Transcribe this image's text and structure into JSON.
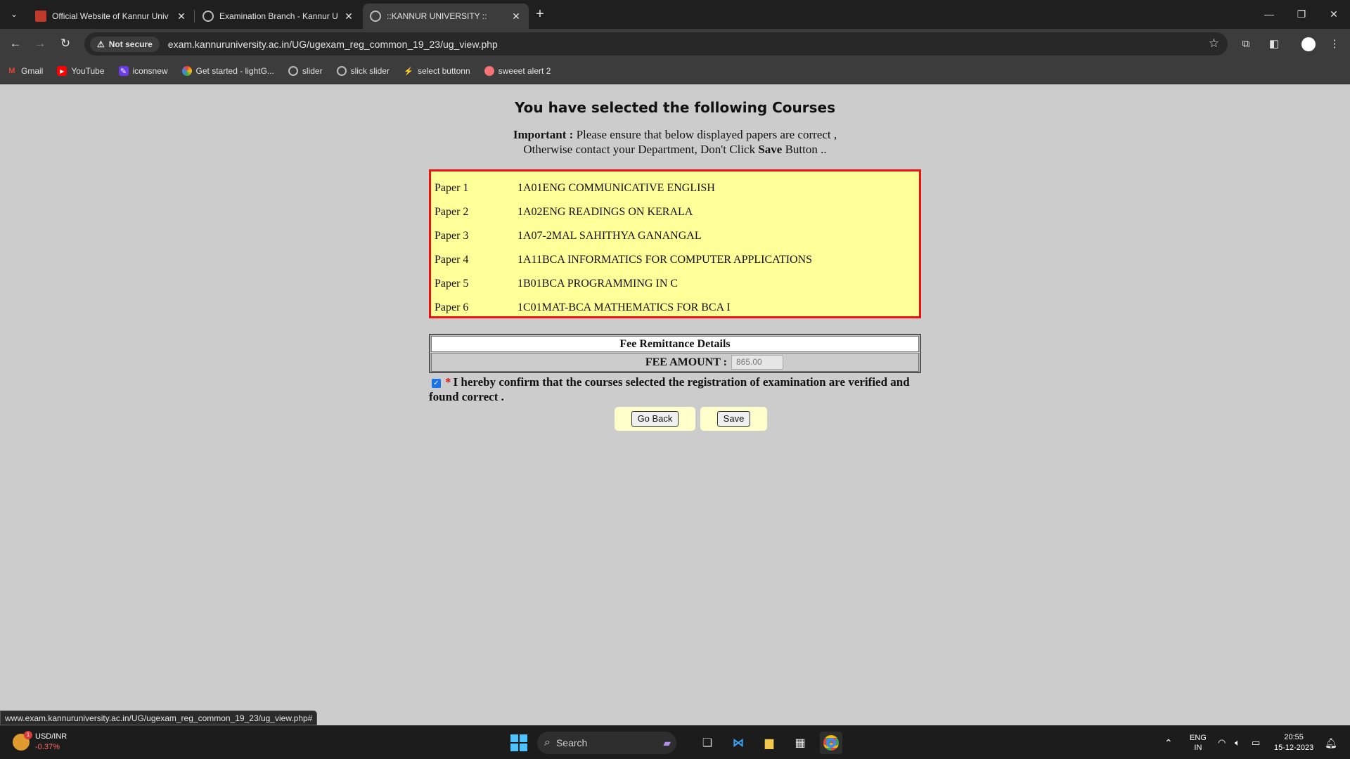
{
  "browser": {
    "tabs": [
      {
        "label": "Official Website of Kannur Univ",
        "active": false
      },
      {
        "label": "Examination Branch - Kannur U",
        "active": false
      },
      {
        "label": "::KANNUR UNIVERSITY ::",
        "active": true
      }
    ],
    "security_label": "Not secure",
    "url": "exam.kannuruniversity.ac.in/UG/ugexam_reg_common_19_23/ug_view.php",
    "bookmarks": [
      {
        "label": "Gmail",
        "icon": "gmail-icon"
      },
      {
        "label": "YouTube",
        "icon": "youtube-icon"
      },
      {
        "label": "iconsnew",
        "icon": "iconsnew-icon"
      },
      {
        "label": "Get started - lightG...",
        "icon": "lightgallery-icon"
      },
      {
        "label": "slider",
        "icon": "globe-icon"
      },
      {
        "label": "slick slider",
        "icon": "globe-icon"
      },
      {
        "label": "select buttonn",
        "icon": "bolt-icon"
      },
      {
        "label": "sweeet alert 2",
        "icon": "sweetalert-icon"
      }
    ],
    "status_url": "www.exam.kannuruniversity.ac.in/UG/ugexam_reg_common_19_23/ug_view.php#"
  },
  "page": {
    "heading": "You have selected the following Courses",
    "important_label": "Important :",
    "important_text_1": "Please ensure that below displayed papers are correct ,",
    "important_text_2a": "Otherwise contact your Department, Don't Click",
    "important_save": "Save",
    "important_text_2b": "Button ..",
    "papers": [
      {
        "no": "Paper 1",
        "title": "1A01ENG COMMUNICATIVE ENGLISH"
      },
      {
        "no": "Paper 2",
        "title": "1A02ENG READINGS ON KERALA"
      },
      {
        "no": "Paper 3",
        "title": "1A07-2MAL SAHITHYA GANANGAL"
      },
      {
        "no": "Paper 4",
        "title": "1A11BCA INFORMATICS FOR COMPUTER APPLICATIONS"
      },
      {
        "no": "Paper 5",
        "title": "1B01BCA PROGRAMMING IN C"
      },
      {
        "no": "Paper 6",
        "title": "1C01MAT-BCA MATHEMATICS FOR BCA I"
      }
    ],
    "fee_heading": "Fee Remittance Details",
    "fee_label": "FEE AMOUNT :",
    "fee_value": "865.00",
    "confirm_checked": true,
    "confirm_star": "*",
    "confirm_text": "I hereby confirm that the courses selected the registration of examination are verified and found correct .",
    "go_back_label": "Go Back",
    "save_label": "Save"
  },
  "taskbar": {
    "ticker_name": "USD/INR",
    "ticker_change": "-0.37%",
    "ticker_badge": "1",
    "search_label": "Search",
    "lang_1": "ENG",
    "lang_2": "IN",
    "time": "20:55",
    "date": "15-12-2023"
  }
}
